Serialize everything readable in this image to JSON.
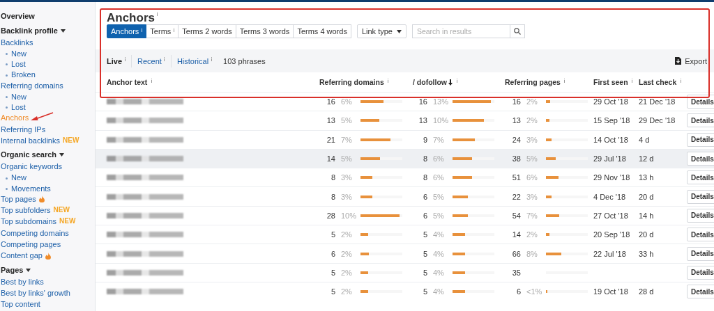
{
  "sidebar": {
    "groups": [
      {
        "heading": "Overview",
        "caret": false
      },
      {
        "heading": "Backlink profile",
        "caret": true,
        "items": [
          {
            "label": "Backlinks",
            "selected": false,
            "children": [
              {
                "label": "New"
              },
              {
                "label": "Lost"
              },
              {
                "label": "Broken"
              }
            ]
          },
          {
            "label": "Referring domains",
            "selected": false,
            "children": [
              {
                "label": "New"
              },
              {
                "label": "Lost"
              }
            ]
          },
          {
            "label": "Anchors",
            "selected": true
          },
          {
            "label": "Referring IPs",
            "selected": false
          },
          {
            "label": "Internal backlinks",
            "selected": false,
            "badge": "NEW"
          }
        ]
      },
      {
        "heading": "Organic search",
        "caret": true,
        "items": [
          {
            "label": "Organic keywords",
            "selected": false,
            "children": [
              {
                "label": "New"
              },
              {
                "label": "Movements"
              }
            ]
          },
          {
            "label": "Top pages",
            "selected": false,
            "hot": true
          },
          {
            "label": "Top subfolders",
            "selected": false,
            "badge": "NEW"
          },
          {
            "label": "Top subdomains",
            "selected": false,
            "badge": "NEW"
          },
          {
            "label": "Competing domains",
            "selected": false
          },
          {
            "label": "Competing pages",
            "selected": false
          },
          {
            "label": "Content gap",
            "selected": false,
            "hot": true
          }
        ]
      },
      {
        "heading": "Pages",
        "caret": true,
        "items": [
          {
            "label": "Best by links",
            "selected": false
          },
          {
            "label": "Best by links' growth",
            "selected": false
          },
          {
            "label": "Top content",
            "selected": false
          }
        ]
      }
    ]
  },
  "title": "Anchors",
  "title_info": true,
  "tabs": [
    {
      "label": "Anchors",
      "info": true,
      "selected": true
    },
    {
      "label": "Terms",
      "info": true,
      "selected": false
    },
    {
      "label": "Terms 2 words",
      "info": false,
      "selected": false
    },
    {
      "label": "Terms 3 words",
      "info": false,
      "selected": false
    },
    {
      "label": "Terms 4 words",
      "info": false,
      "selected": false
    }
  ],
  "link_type": {
    "label": "Link type"
  },
  "search": {
    "placeholder": "Search in results"
  },
  "modes": [
    {
      "label": "Live",
      "info": true,
      "selected": true
    },
    {
      "label": "Recent",
      "info": true,
      "selected": false
    },
    {
      "label": "Historical",
      "info": true,
      "selected": false
    }
  ],
  "count": "103 phrases",
  "export": "Export",
  "columns": [
    {
      "label": "Anchor text",
      "info": true,
      "sorted": false
    },
    {
      "label": "Referring domains",
      "info": true,
      "sorted": false
    },
    {
      "label": "/ dofollow",
      "info": true,
      "sorted": true
    },
    {
      "label": "Referring pages",
      "info": true,
      "sorted": false
    },
    {
      "label": "First seen",
      "info": true,
      "sorted": false
    },
    {
      "label": "Last check",
      "info": true,
      "sorted": false
    }
  ],
  "rows": [
    {
      "anchor_redacted": true,
      "hovered": false,
      "domains": {
        "value": "16",
        "pct": "6%",
        "level": 0.55
      },
      "dofollow": {
        "value": "16",
        "pct": "13%",
        "level": 0.92
      },
      "pages": {
        "value": "16",
        "pct": "2%",
        "level": 0.1
      },
      "first_seen": "29 Oct '18",
      "last_check": "21 Dec '18",
      "action": "Details"
    },
    {
      "anchor_redacted": true,
      "hovered": false,
      "domains": {
        "value": "13",
        "pct": "5%",
        "level": 0.45
      },
      "dofollow": {
        "value": "13",
        "pct": "10%",
        "level": 0.75
      },
      "pages": {
        "value": "13",
        "pct": "2%",
        "level": 0.08
      },
      "first_seen": "15 Sep '18",
      "last_check": "29 Dec '18",
      "action": "Details"
    },
    {
      "anchor_redacted": true,
      "hovered": false,
      "domains": {
        "value": "21",
        "pct": "7%",
        "level": 0.72
      },
      "dofollow": {
        "value": "9",
        "pct": "7%",
        "level": 0.53
      },
      "pages": {
        "value": "24",
        "pct": "3%",
        "level": 0.14
      },
      "first_seen": "14 Oct '18",
      "last_check": "4 d",
      "action": "Details"
    },
    {
      "anchor_redacted": true,
      "hovered": true,
      "domains": {
        "value": "14",
        "pct": "5%",
        "level": 0.47
      },
      "dofollow": {
        "value": "8",
        "pct": "6%",
        "level": 0.47
      },
      "pages": {
        "value": "38",
        "pct": "5%",
        "level": 0.23
      },
      "first_seen": "29 Jul '18",
      "last_check": "12 d",
      "action": "Details"
    },
    {
      "anchor_redacted": true,
      "hovered": false,
      "domains": {
        "value": "8",
        "pct": "3%",
        "level": 0.28
      },
      "dofollow": {
        "value": "8",
        "pct": "6%",
        "level": 0.47
      },
      "pages": {
        "value": "51",
        "pct": "6%",
        "level": 0.3
      },
      "first_seen": "29 Nov '18",
      "last_check": "13 h",
      "action": "Details"
    },
    {
      "anchor_redacted": true,
      "hovered": false,
      "domains": {
        "value": "8",
        "pct": "3%",
        "level": 0.28
      },
      "dofollow": {
        "value": "6",
        "pct": "5%",
        "level": 0.37
      },
      "pages": {
        "value": "22",
        "pct": "3%",
        "level": 0.13
      },
      "first_seen": "4 Dec '18",
      "last_check": "20 d",
      "action": "Details"
    },
    {
      "anchor_redacted": true,
      "hovered": false,
      "domains": {
        "value": "28",
        "pct": "10%",
        "level": 0.93
      },
      "dofollow": {
        "value": "6",
        "pct": "5%",
        "level": 0.37
      },
      "pages": {
        "value": "54",
        "pct": "7%",
        "level": 0.31
      },
      "first_seen": "27 Oct '18",
      "last_check": "14 h",
      "action": "Details"
    },
    {
      "anchor_redacted": true,
      "hovered": false,
      "domains": {
        "value": "5",
        "pct": "2%",
        "level": 0.18
      },
      "dofollow": {
        "value": "5",
        "pct": "4%",
        "level": 0.3
      },
      "pages": {
        "value": "14",
        "pct": "2%",
        "level": 0.08
      },
      "first_seen": "20 Sep '18",
      "last_check": "20 d",
      "action": "Details"
    },
    {
      "anchor_redacted": true,
      "hovered": false,
      "domains": {
        "value": "6",
        "pct": "2%",
        "level": 0.2
      },
      "dofollow": {
        "value": "5",
        "pct": "4%",
        "level": 0.3
      },
      "pages": {
        "value": "66",
        "pct": "8%",
        "level": 0.37
      },
      "first_seen": "22 Jul '18",
      "last_check": "33 h",
      "action": "Details"
    },
    {
      "anchor_redacted": true,
      "hovered": false,
      "domains": {
        "value": "5",
        "pct": "2%",
        "level": 0.18
      },
      "dofollow": {
        "value": "5",
        "pct": "4%",
        "level": 0.3
      },
      "pages": {
        "value": "35"
      },
      "action": "Details"
    },
    {
      "anchor_redacted": true,
      "hovered": false,
      "domains": {
        "value": "5",
        "pct": "2%",
        "level": 0.18
      },
      "dofollow": {
        "value": "5",
        "pct": "4%",
        "level": 0.3
      },
      "pages": {
        "value": "6",
        "pct": "<1%",
        "level": 0.03
      },
      "first_seen": "19 Oct '18",
      "last_check": "28 d",
      "action": "Details"
    }
  ]
}
